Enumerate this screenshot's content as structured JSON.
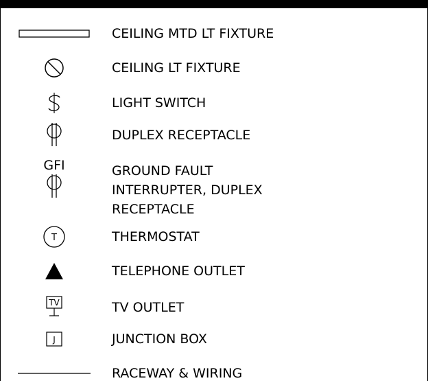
{
  "legend": {
    "items": [
      {
        "symbol": "ceiling-mounted-light-fixture-icon",
        "label": "CEILING MTD LT FIXTURE"
      },
      {
        "symbol": "ceiling-light-fixture-icon",
        "label": "CEILING LT FIXTURE"
      },
      {
        "symbol": "light-switch-icon",
        "label": "LIGHT SWITCH"
      },
      {
        "symbol": "duplex-receptacle-icon",
        "label": "DUPLEX RECEPTACLE"
      },
      {
        "symbol": "gfi-duplex-receptacle-icon",
        "symbol_text": "GFI",
        "label_lines": [
          "GROUND FAULT",
          "INTERRUPTER, DUPLEX",
          "RECEPTACLE"
        ]
      },
      {
        "symbol": "thermostat-icon",
        "symbol_text": "T",
        "label": "THERMOSTAT"
      },
      {
        "symbol": "telephone-outlet-icon",
        "label": "TELEPHONE OUTLET"
      },
      {
        "symbol": "tv-outlet-icon",
        "symbol_text": "TV",
        "label": "TV OUTLET"
      },
      {
        "symbol": "junction-box-icon",
        "symbol_text": "J",
        "label": "JUNCTION BOX"
      },
      {
        "symbol": "raceway-wiring-icon",
        "label": "RACEWAY & WIRING"
      }
    ]
  }
}
